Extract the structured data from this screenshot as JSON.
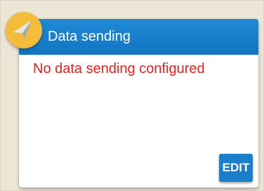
{
  "card": {
    "title": "Data sending",
    "status": "No data sending configured",
    "edit_label": "EDIT",
    "icon": "paper-plane-icon"
  },
  "colors": {
    "header_blue": "#1b82cf",
    "badge_yellow": "#f3bd3a",
    "status_red": "#e81f1f",
    "background": "#ece6d7"
  }
}
